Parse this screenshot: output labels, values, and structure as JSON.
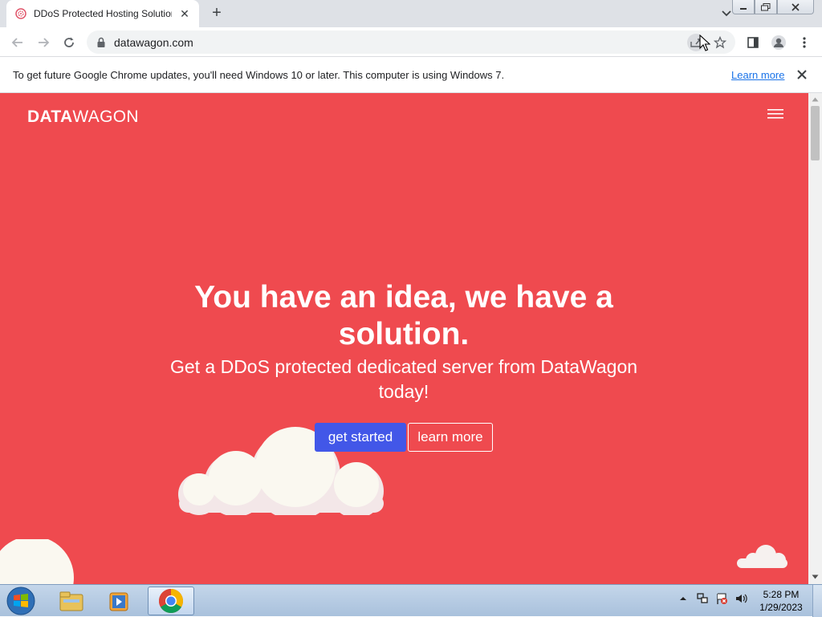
{
  "browser": {
    "tab": {
      "title": "DDoS Protected Hosting Solution",
      "close_icon": "close-icon",
      "favicon": "datawagon-favicon"
    },
    "new_tab_label": "+",
    "address": "datawagon.com",
    "infobar": {
      "message": "To get future Google Chrome updates, you'll need Windows 10 or later. This computer is using Windows 7.",
      "link": "Learn more"
    }
  },
  "page": {
    "logo": {
      "bold": "DATA",
      "light": "WAGON"
    },
    "hero_title": "You have an idea, we have a solution.",
    "hero_subtitle": "Get a DDoS protected dedicated server from DataWagon today!",
    "primary_button": "get started",
    "secondary_button": "learn more",
    "colors": {
      "background": "#ef4a4f",
      "primary_button": "#4257e8",
      "text": "#ffffff"
    }
  },
  "taskbar": {
    "clock_time": "5:28 PM",
    "clock_date": "1/29/2023",
    "apps": [
      "windows-explorer-icon",
      "media-player-icon",
      "chrome-icon"
    ]
  }
}
